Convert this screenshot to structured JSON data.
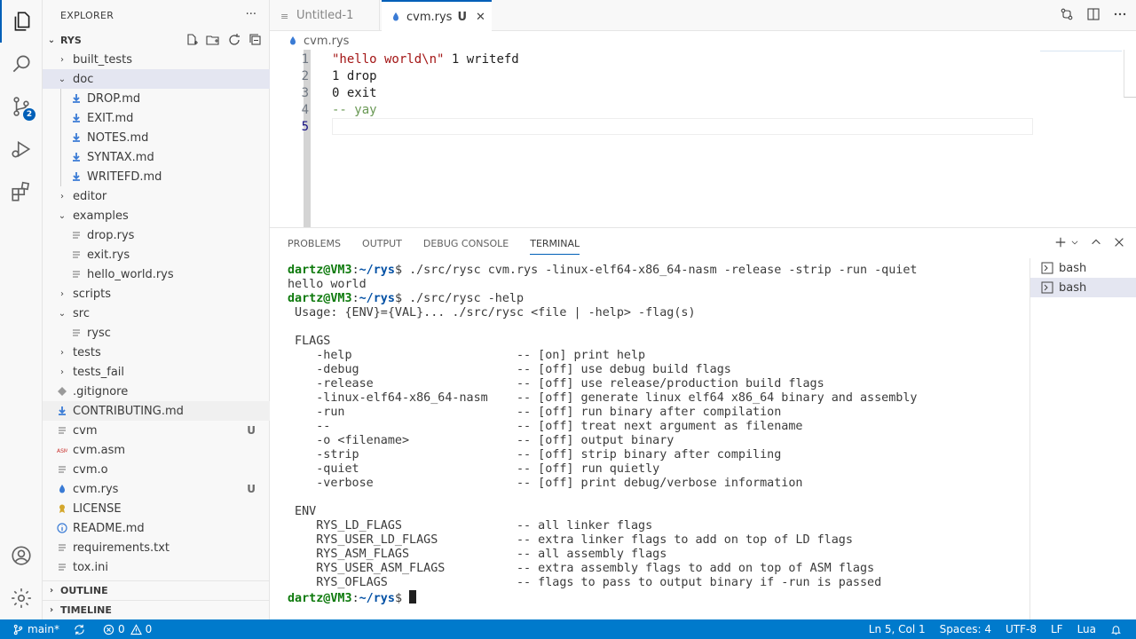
{
  "colors": {
    "accent": "#005fb8",
    "statusbar": "#007acc",
    "prompt_user": "#0e7a0d",
    "prompt_path": "#0451a5"
  },
  "activity": {
    "scm_badge": "2"
  },
  "sidebar": {
    "title": "EXPLORER",
    "more": "···",
    "root": "RYS",
    "items": [
      {
        "label": "built_tests",
        "kind": "folder",
        "open": false,
        "depth": 0
      },
      {
        "label": "doc",
        "kind": "folder",
        "open": true,
        "depth": 0
      },
      {
        "label": "DROP.md",
        "kind": "md",
        "depth": 1
      },
      {
        "label": "EXIT.md",
        "kind": "md",
        "depth": 1
      },
      {
        "label": "NOTES.md",
        "kind": "md",
        "depth": 1
      },
      {
        "label": "SYNTAX.md",
        "kind": "md",
        "depth": 1
      },
      {
        "label": "WRITEFD.md",
        "kind": "md",
        "depth": 1
      },
      {
        "label": "editor",
        "kind": "folder",
        "open": false,
        "depth": 0
      },
      {
        "label": "examples",
        "kind": "folder",
        "open": true,
        "depth": 0
      },
      {
        "label": "drop.rys",
        "kind": "file",
        "depth": 1
      },
      {
        "label": "exit.rys",
        "kind": "file",
        "depth": 1
      },
      {
        "label": "hello_world.rys",
        "kind": "file",
        "depth": 1
      },
      {
        "label": "scripts",
        "kind": "folder",
        "open": false,
        "depth": 0
      },
      {
        "label": "src",
        "kind": "folder",
        "open": true,
        "depth": 0
      },
      {
        "label": "rysc",
        "kind": "file",
        "depth": 1
      },
      {
        "label": "tests",
        "kind": "folder",
        "open": false,
        "depth": 0
      },
      {
        "label": "tests_fail",
        "kind": "folder",
        "open": false,
        "depth": 0
      },
      {
        "label": ".gitignore",
        "kind": "git",
        "depth": 0
      },
      {
        "label": "CONTRIBUTING.md",
        "kind": "md",
        "depth": 0
      },
      {
        "label": "cvm",
        "kind": "file",
        "depth": 0,
        "status": "U"
      },
      {
        "label": "cvm.asm",
        "kind": "asm",
        "depth": 0
      },
      {
        "label": "cvm.o",
        "kind": "file",
        "depth": 0
      },
      {
        "label": "cvm.rys",
        "kind": "rys",
        "depth": 0,
        "status": "U"
      },
      {
        "label": "LICENSE",
        "kind": "license",
        "depth": 0
      },
      {
        "label": "README.md",
        "kind": "info",
        "depth": 0
      },
      {
        "label": "requirements.txt",
        "kind": "file",
        "depth": 0
      },
      {
        "label": "tox.ini",
        "kind": "file",
        "depth": 0
      }
    ],
    "outline": "OUTLINE",
    "timeline": "TIMELINE"
  },
  "tabs": [
    {
      "label": "Untitled-1",
      "active": false
    },
    {
      "label": "cvm.rys",
      "active": true,
      "status": "U",
      "close": "✕"
    }
  ],
  "breadcrumb": "cvm.rys",
  "editor": {
    "lines": [
      {
        "n": "1",
        "parts": [
          {
            "t": "\"hello world\\n\"",
            "c": "str"
          },
          {
            "t": " 1 writefd",
            "c": "plain"
          }
        ]
      },
      {
        "n": "2",
        "parts": [
          {
            "t": "1 drop",
            "c": "plain"
          }
        ]
      },
      {
        "n": "3",
        "parts": [
          {
            "t": "0 exit",
            "c": "plain"
          }
        ]
      },
      {
        "n": "4",
        "parts": [
          {
            "t": "-- yay",
            "c": "cmt"
          }
        ]
      },
      {
        "n": "5",
        "parts": []
      }
    ]
  },
  "panel": {
    "tabs": [
      "PROBLEMS",
      "OUTPUT",
      "DEBUG CONSOLE",
      "TERMINAL"
    ],
    "active_tab": "TERMINAL",
    "terminals": [
      "bash",
      "bash"
    ],
    "prompt_user": "dartz@VM3",
    "prompt_sep": ":",
    "prompt_path": "~/rys",
    "prompt_end": "$ ",
    "lines": [
      {
        "prompt": true,
        "text": "./src/rysc cvm.rys -linux-elf64-x86_64-nasm -release -strip -run -quiet"
      },
      {
        "prompt": false,
        "text": "hello world"
      },
      {
        "prompt": true,
        "text": "./src/rysc -help"
      },
      {
        "prompt": false,
        "text": " Usage: {ENV}={VAL}... ./src/rysc <file | -help> -flag(s)"
      },
      {
        "prompt": false,
        "text": ""
      },
      {
        "prompt": false,
        "text": " FLAGS"
      },
      {
        "prompt": false,
        "text": "    -help                       -- [on] print help"
      },
      {
        "prompt": false,
        "text": "    -debug                      -- [off] use debug build flags"
      },
      {
        "prompt": false,
        "text": "    -release                    -- [off] use release/production build flags"
      },
      {
        "prompt": false,
        "text": "    -linux-elf64-x86_64-nasm    -- [off] generate linux elf64 x86_64 binary and assembly"
      },
      {
        "prompt": false,
        "text": "    -run                        -- [off] run binary after compilation"
      },
      {
        "prompt": false,
        "text": "    --                          -- [off] treat next argument as filename"
      },
      {
        "prompt": false,
        "text": "    -o <filename>               -- [off] output binary"
      },
      {
        "prompt": false,
        "text": "    -strip                      -- [off] strip binary after compiling"
      },
      {
        "prompt": false,
        "text": "    -quiet                      -- [off] run quietly"
      },
      {
        "prompt": false,
        "text": "    -verbose                    -- [off] print debug/verbose information"
      },
      {
        "prompt": false,
        "text": ""
      },
      {
        "prompt": false,
        "text": " ENV"
      },
      {
        "prompt": false,
        "text": "    RYS_LD_FLAGS                -- all linker flags"
      },
      {
        "prompt": false,
        "text": "    RYS_USER_LD_FLAGS           -- extra linker flags to add on top of LD flags"
      },
      {
        "prompt": false,
        "text": "    RYS_ASM_FLAGS               -- all assembly flags"
      },
      {
        "prompt": false,
        "text": "    RYS_USER_ASM_FLAGS          -- extra assembly flags to add on top of ASM flags"
      },
      {
        "prompt": false,
        "text": "    RYS_OFLAGS                  -- flags to pass to output binary if -run is passed"
      },
      {
        "prompt": true,
        "text": "",
        "cursor": true
      }
    ]
  },
  "status": {
    "branch": "main*",
    "errors": "0",
    "warnings": "0",
    "position": "Ln 5, Col 1",
    "spaces": "Spaces: 4",
    "encoding": "UTF-8",
    "eol": "LF",
    "language": "Lua"
  }
}
